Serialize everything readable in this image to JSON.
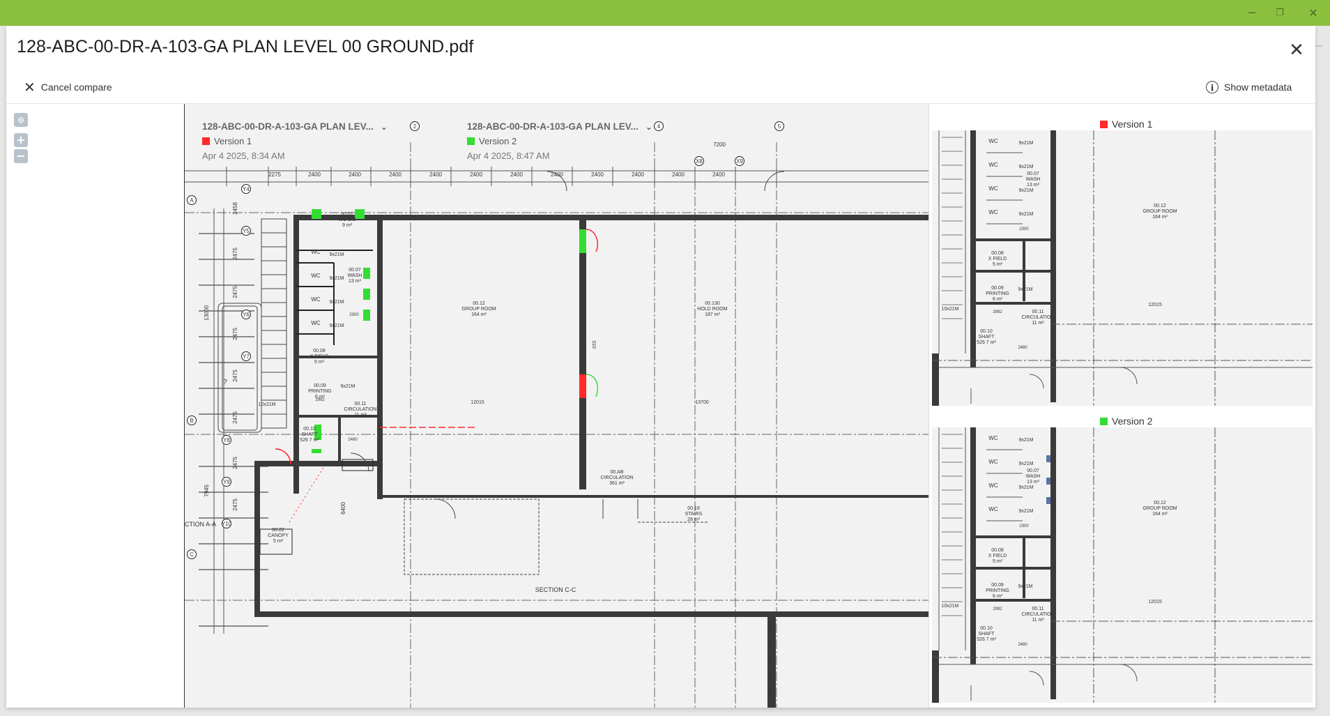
{
  "window": {
    "minimize_icon": "minimize-icon",
    "restore_icon": "restore-icon",
    "close_icon": "close-icon",
    "back_icon": "arrow-left-icon"
  },
  "document": {
    "title": "128-ABC-00-DR-A-103-GA PLAN LEVEL 00 GROUND.pdf"
  },
  "toolbar": {
    "cancel_label": "Cancel compare",
    "metadata_label": "Show metadata"
  },
  "zoom": {
    "fit_icon": "fit-to-screen-icon",
    "zoom_in": "+",
    "zoom_out": "−"
  },
  "versions": [
    {
      "file": "128-ABC-00-DR-A-103-GA PLAN LEV...",
      "label": "Version 1",
      "date": "Apr 4 2025, 8:34 AM",
      "color": "#ff2a2a"
    },
    {
      "file": "128-ABC-00-DR-A-103-GA PLAN LEV...",
      "label": "Version 2",
      "date": "Apr 4 2025, 8:47 AM",
      "color": "#33dd33"
    }
  ],
  "drawing": {
    "grid_cols": [
      "2",
      "4",
      "5",
      "X8",
      "X9"
    ],
    "grid_rows": [
      "A",
      "B",
      "C"
    ],
    "grid_sub_rows": [
      "Y4",
      "Y5",
      "Y6",
      "Y7",
      "Y8",
      "Y9",
      "Y10"
    ],
    "dims_top": [
      "2275",
      "2400",
      "2400",
      "2400",
      "2400",
      "2400",
      "2400",
      "2400",
      "2400",
      "2400",
      "2400",
      "2400"
    ],
    "dim_7200": "7200",
    "dims_left": [
      "2458",
      "2475",
      "2475",
      "2475",
      "2475",
      "2475",
      "2475",
      "2475"
    ],
    "dim_13000": "13000",
    "dim_7945": "7945",
    "dim_6400": "6400",
    "dim_12015": "12015",
    "dim_13700": "13700",
    "dim_310": "310",
    "rooms": {
      "wc_dis": [
        "00.01",
        "WC DIS",
        "9 m²"
      ],
      "wash": [
        "00.07",
        "WASH",
        "13 m²"
      ],
      "group_room": [
        "00.12",
        "GROUP ROOM",
        "164 m²"
      ],
      "hold_room": [
        "00.130",
        "HOLD ROOM",
        "187 m²"
      ],
      "x_field": [
        "00.08",
        "X FIELD",
        "5 m²"
      ],
      "printing": [
        "00.09",
        "PRINTING",
        "6 m²"
      ],
      "circulation_small": [
        "00.11",
        "CIRCULATION",
        "11 m²"
      ],
      "shaft": [
        "00.10",
        "SHAFT",
        "526 7 m²"
      ],
      "circulation_main": [
        "00.AB",
        "CIRCULATION",
        "361 m²"
      ],
      "stairs": [
        "00.19",
        "STAIRS",
        "28 m²"
      ],
      "canopy": [
        "00.22",
        "CANOPY",
        "5 m²"
      ]
    },
    "wc": "WC",
    "door_tag": "9x21M",
    "door_tag_2": "10x21M",
    "dim_2992": "2992",
    "dim_2480": "2480",
    "dim_2300": "2300",
    "section_aa": "CTION A-A",
    "section_cc": "SECTION C-C",
    "question": "?"
  }
}
